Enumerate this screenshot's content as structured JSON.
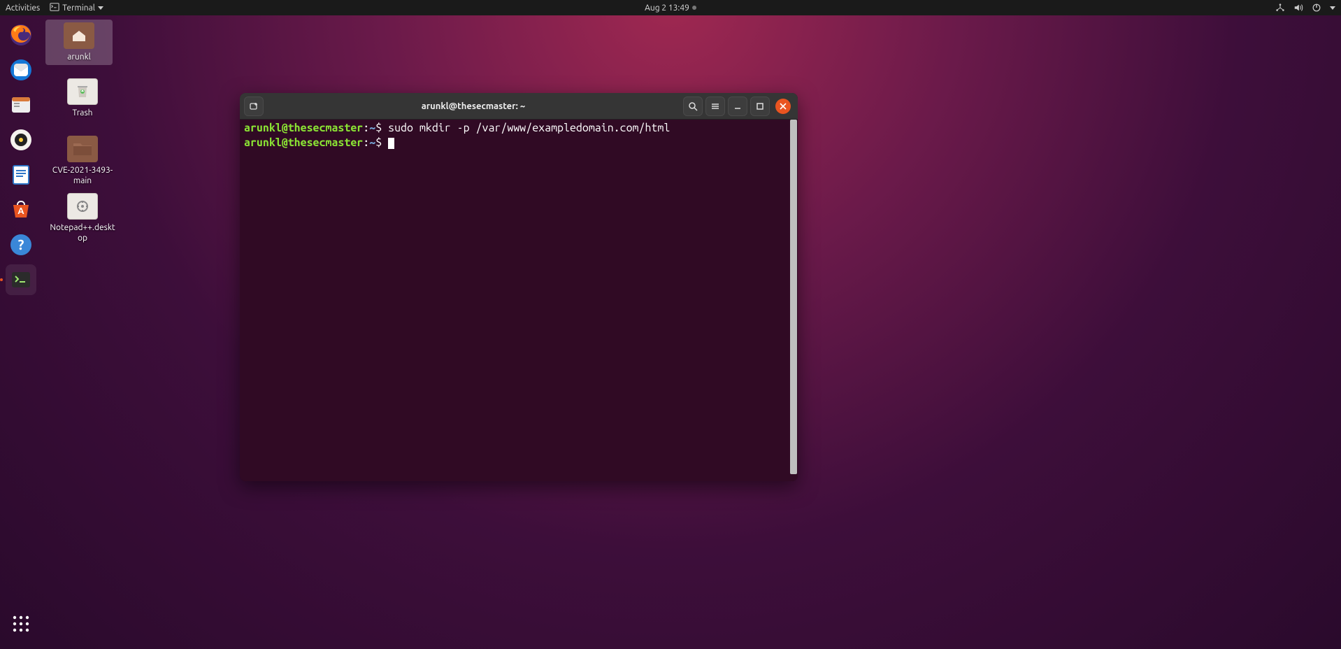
{
  "topbar": {
    "activities": "Activities",
    "app_label": "Terminal",
    "datetime": "Aug 2  13:49"
  },
  "dock": {
    "apps_name": "show-applications"
  },
  "desktop_icons": [
    {
      "label": "arunkl",
      "name": "home-folder"
    },
    {
      "label": "Trash",
      "name": "trash-folder"
    },
    {
      "label": "CVE-2021-3493-main",
      "name": "cve-folder"
    },
    {
      "label": "Notepad++.desktop",
      "name": "notepadpp-desktop"
    }
  ],
  "terminal": {
    "window_title": "arunkl@thesecmaster: ~",
    "lines": [
      {
        "userhost": "arunkl@thesecmaster",
        "sep": ":",
        "path": "~",
        "dollar": "$",
        "cmd": " sudo mkdir -p /var/www/exampledomain.com/html"
      },
      {
        "userhost": "arunkl@thesecmaster",
        "sep": ":",
        "path": "~",
        "dollar": "$",
        "cmd": " "
      }
    ]
  }
}
